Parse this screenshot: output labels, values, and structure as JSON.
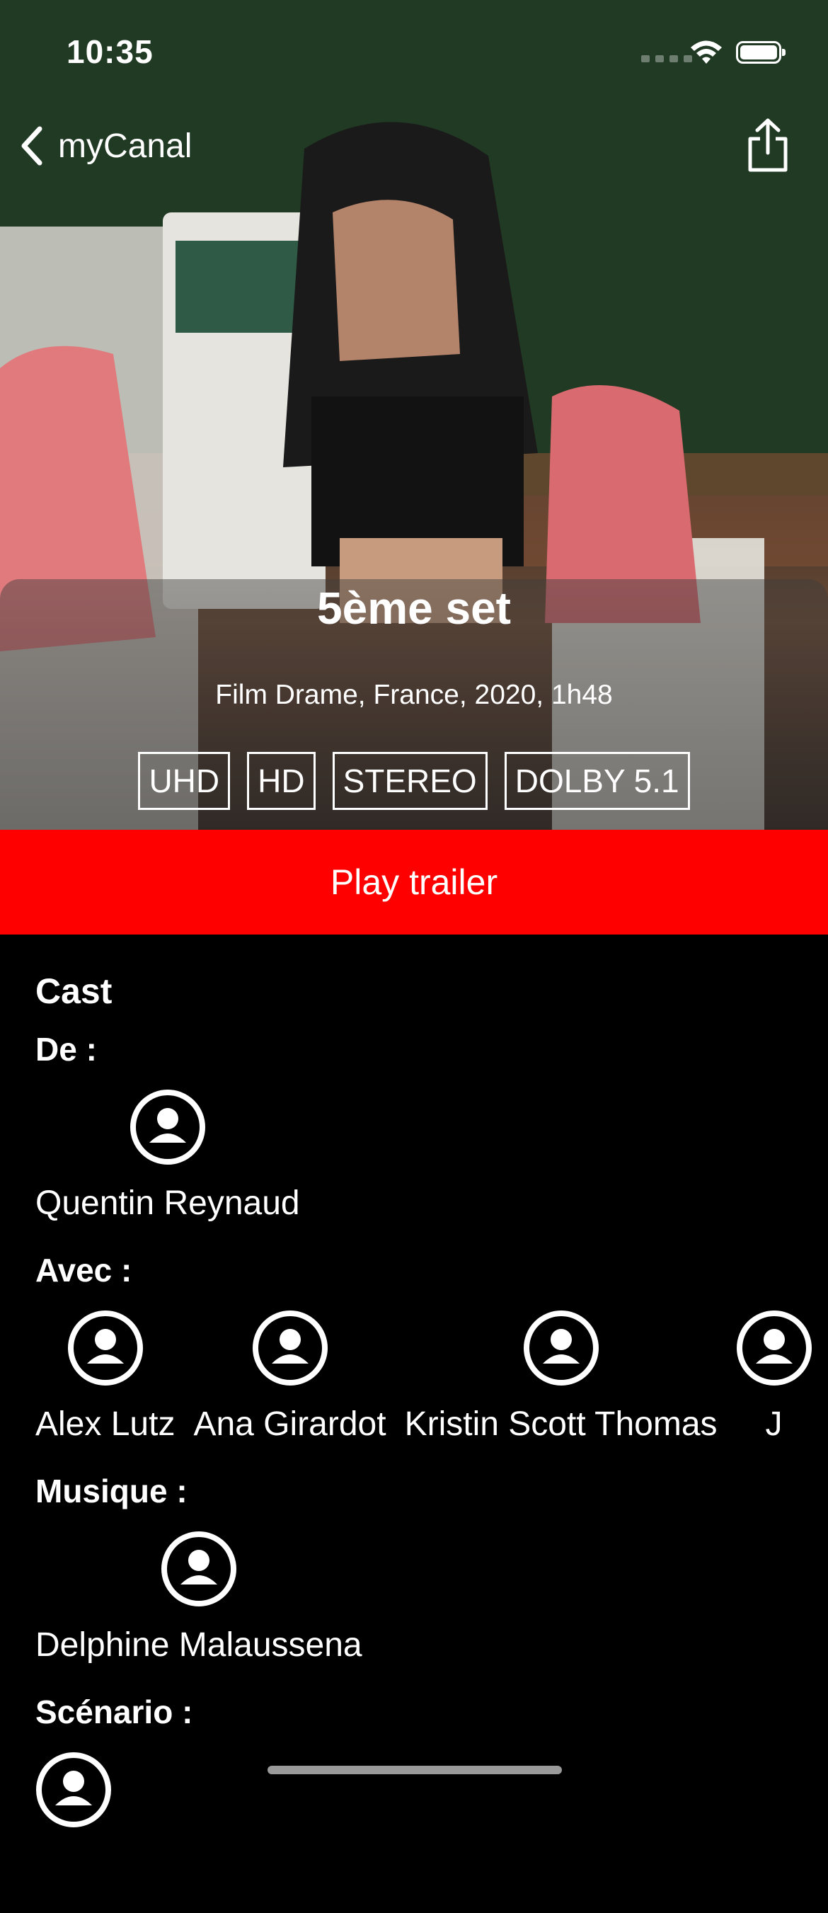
{
  "status": {
    "time": "10:35"
  },
  "nav": {
    "back_label": "myCanal"
  },
  "movie": {
    "title": "5ème set",
    "meta": "Film Drame, France, 2020, 1h48",
    "badges": [
      "UHD",
      "HD",
      "STEREO",
      "DOLBY 5.1"
    ]
  },
  "cta": {
    "label": "Play trailer"
  },
  "cast": {
    "heading": "Cast",
    "groups": [
      {
        "role": "De :",
        "people": [
          "Quentin Reynaud"
        ]
      },
      {
        "role": "Avec :",
        "people": [
          "Alex Lutz",
          "Ana Girardot",
          "Kristin Scott Thomas",
          "J"
        ]
      },
      {
        "role": "Musique :",
        "people": [
          "Delphine Malaussena"
        ]
      },
      {
        "role": "Scénario :",
        "people": []
      }
    ]
  },
  "colors": {
    "accent": "#ff0000",
    "background": "#000000"
  }
}
